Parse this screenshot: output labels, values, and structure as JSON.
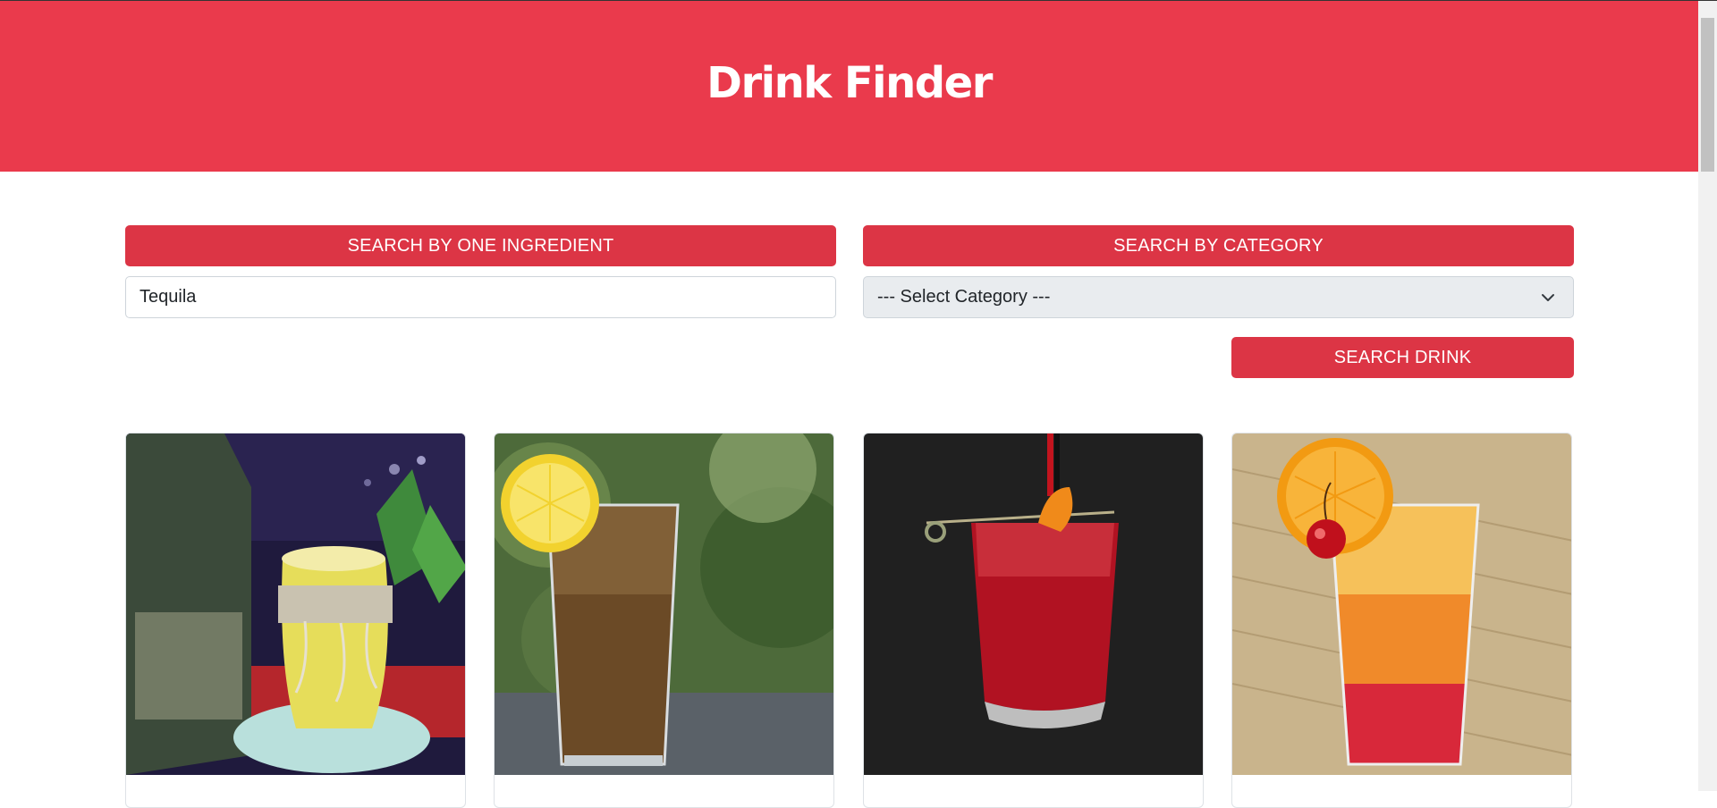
{
  "header": {
    "title": "Drink Finder"
  },
  "search": {
    "ingredient_button": "Search by one ingredient",
    "category_button": "Search by category",
    "ingredient_value": "Tequila",
    "category_selected": "--- Select Category ---",
    "submit_button": "Search drink"
  },
  "colors": {
    "header_bg": "#ea3a4c",
    "button_bg": "#dc3545",
    "select_bg": "#e9ecef"
  },
  "cards": [
    {
      "image": "lemonade-whiskey-cocktail-photo"
    },
    {
      "image": "cola-highball-with-lemon-photo"
    },
    {
      "image": "red-negroni-on-black-photo"
    },
    {
      "image": "tequila-sunrise-with-orange-cherry-photo"
    }
  ]
}
